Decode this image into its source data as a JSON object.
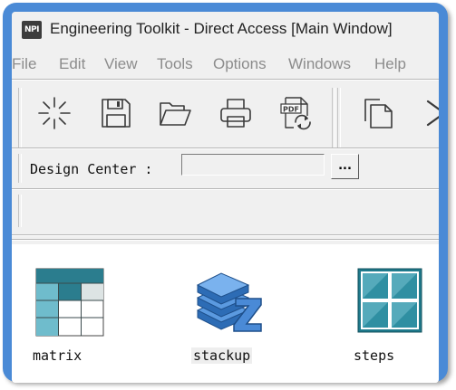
{
  "window": {
    "app_logo_text": "NPI",
    "title": "Engineering Toolkit - Direct Access [Main Window]"
  },
  "menu": {
    "items": [
      "File",
      "Edit",
      "View",
      "Tools",
      "Options",
      "Windows",
      "Help"
    ]
  },
  "toolbar": {
    "buttons": [
      {
        "icon": "sparkle-icon"
      },
      {
        "icon": "save-icon"
      },
      {
        "icon": "folder-open-icon"
      },
      {
        "icon": "printer-icon"
      },
      {
        "icon": "pdf-refresh-icon",
        "badge_text": "PDF"
      },
      {
        "icon": "copy-icon"
      },
      {
        "icon": "chevron-right-icon"
      }
    ]
  },
  "design_center": {
    "label": "Design Center :",
    "value": "",
    "browse_label": "..."
  },
  "tools": [
    {
      "label": "matrix",
      "icon": "matrix-grid-icon"
    },
    {
      "label": "stackup",
      "icon": "stackup-layers-icon"
    },
    {
      "label": "steps",
      "icon": "steps-grid-icon"
    }
  ],
  "colors": {
    "frame": "#4a8ad6",
    "teal_dark": "#1f7a8c",
    "teal_light": "#6fbccc",
    "stack_blue": "#3a7fd0"
  }
}
